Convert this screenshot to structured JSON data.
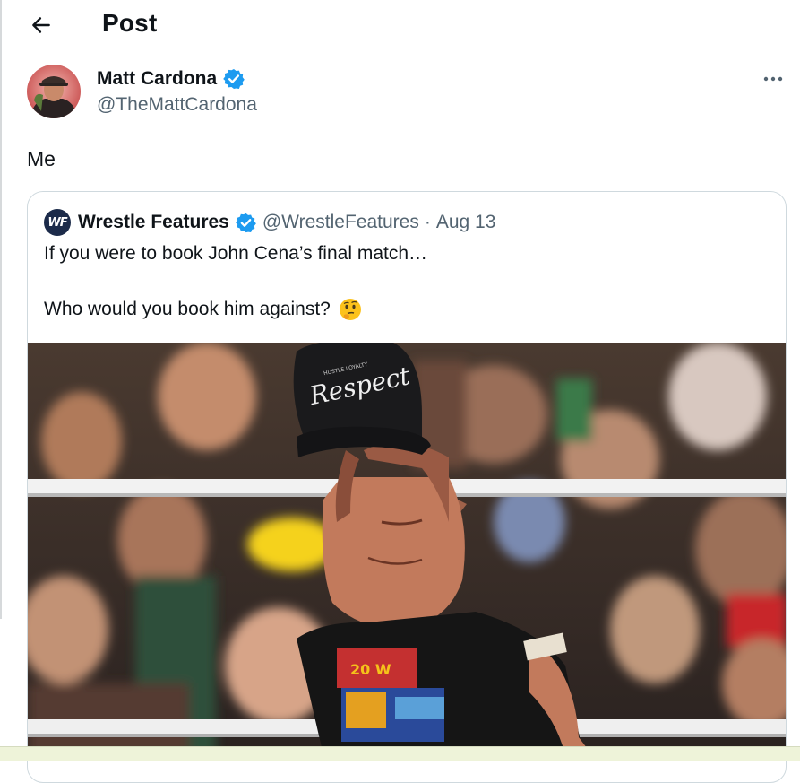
{
  "header": {
    "title": "Post",
    "back_icon": "arrow-left-icon"
  },
  "tweet": {
    "author": {
      "name": "Matt Cardona",
      "handle": "@TheMattCardona",
      "verified": true
    },
    "text": "Me",
    "more_icon": "more-horizontal-icon"
  },
  "quote": {
    "author": {
      "name": "Wrestle Features",
      "handle": "@WrestleFeatures",
      "verified": true,
      "avatar_text": "WF"
    },
    "separator": "·",
    "date": "Aug 13",
    "line1": "If you were to book John Cena’s final match…",
    "line2": "Who would you book him against?",
    "emoji": "thinking-face-icon",
    "media": {
      "cap_text": "Respect",
      "cap_small_text": "HUSTLE LOYALTY"
    }
  },
  "colors": {
    "verified": "#1d9bf0",
    "text_primary": "#0f1419",
    "text_secondary": "#536471",
    "border": "#cfd9de"
  }
}
